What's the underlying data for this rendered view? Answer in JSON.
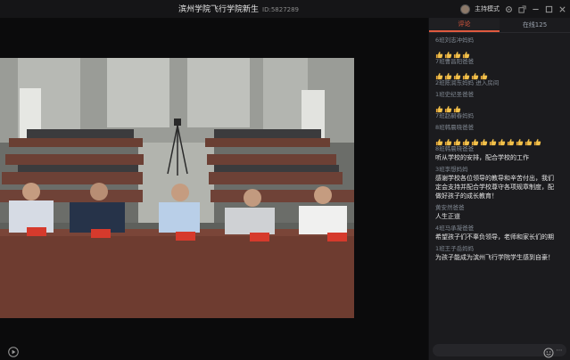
{
  "header": {
    "title": "滨州学院飞行学院新生",
    "room_id": "ID:5827289",
    "host_mode_label": "主持模式"
  },
  "chat": {
    "tabs": [
      {
        "label": "评论"
      },
      {
        "label": "在线125"
      }
    ],
    "messages": [
      {
        "user": "6班刘志冲妈妈",
        "text": "",
        "thumbs": 4
      },
      {
        "user": "7班曹昌阳爸爸",
        "text": "",
        "thumbs": 6
      },
      {
        "user": "2班陈润东妈妈 进入房间",
        "text": "",
        "thumbs": 0
      },
      {
        "user": "1班史纪圣爸爸",
        "text": "",
        "thumbs": 3
      },
      {
        "user": "7班赵嗣春妈妈",
        "text": "",
        "thumbs": 0
      },
      {
        "user": "8班韩晨晓爸爸",
        "text": "",
        "thumbs": 12
      },
      {
        "user": "8班韩晨晓爸爸",
        "text": "听从学校的安排，配合学校的工作",
        "thumbs": 0
      },
      {
        "user": "3班李想妈妈",
        "text": "感谢学校各位领导的教导和辛苦付出，我们\n定会支持并配合学校尊守各项规章制度，配\n做好孩子的成长教育！",
        "thumbs": 0
      },
      {
        "user": "黄安然爸爸",
        "text": "人生正道",
        "thumbs": 0
      },
      {
        "user": "4班马承凝爸爸",
        "text": "希望孩子们不辜负领导，老师和家长们的期",
        "thumbs": 0
      },
      {
        "user": "1班王子岳妈妈",
        "text": "为孩子能成为滨州飞行学院学生感到自豪！",
        "thumbs": 0
      }
    ]
  },
  "colors": {
    "accent": "#e0593f",
    "background": "#111113",
    "panel": "#1b1b1e"
  }
}
